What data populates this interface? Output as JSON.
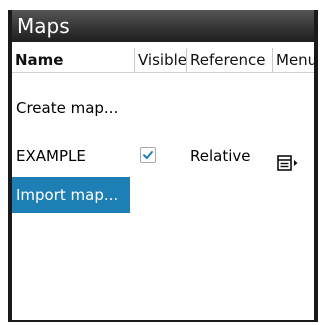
{
  "window": {
    "title": "Maps"
  },
  "columns": {
    "name": "Name",
    "visible": "Visible",
    "reference": "Reference",
    "menu": "Menu"
  },
  "rows": [
    {
      "label": "Create map..."
    },
    {
      "label": "EXAMPLE",
      "visible": true,
      "reference": "Relative",
      "menu_icon": "menu-icon"
    },
    {
      "label": "Import map...",
      "highlighted": true
    }
  ],
  "colors": {
    "highlight": "#1e7fb5",
    "check": "#1e7fb5",
    "titlebar": "#3b3b3b"
  }
}
